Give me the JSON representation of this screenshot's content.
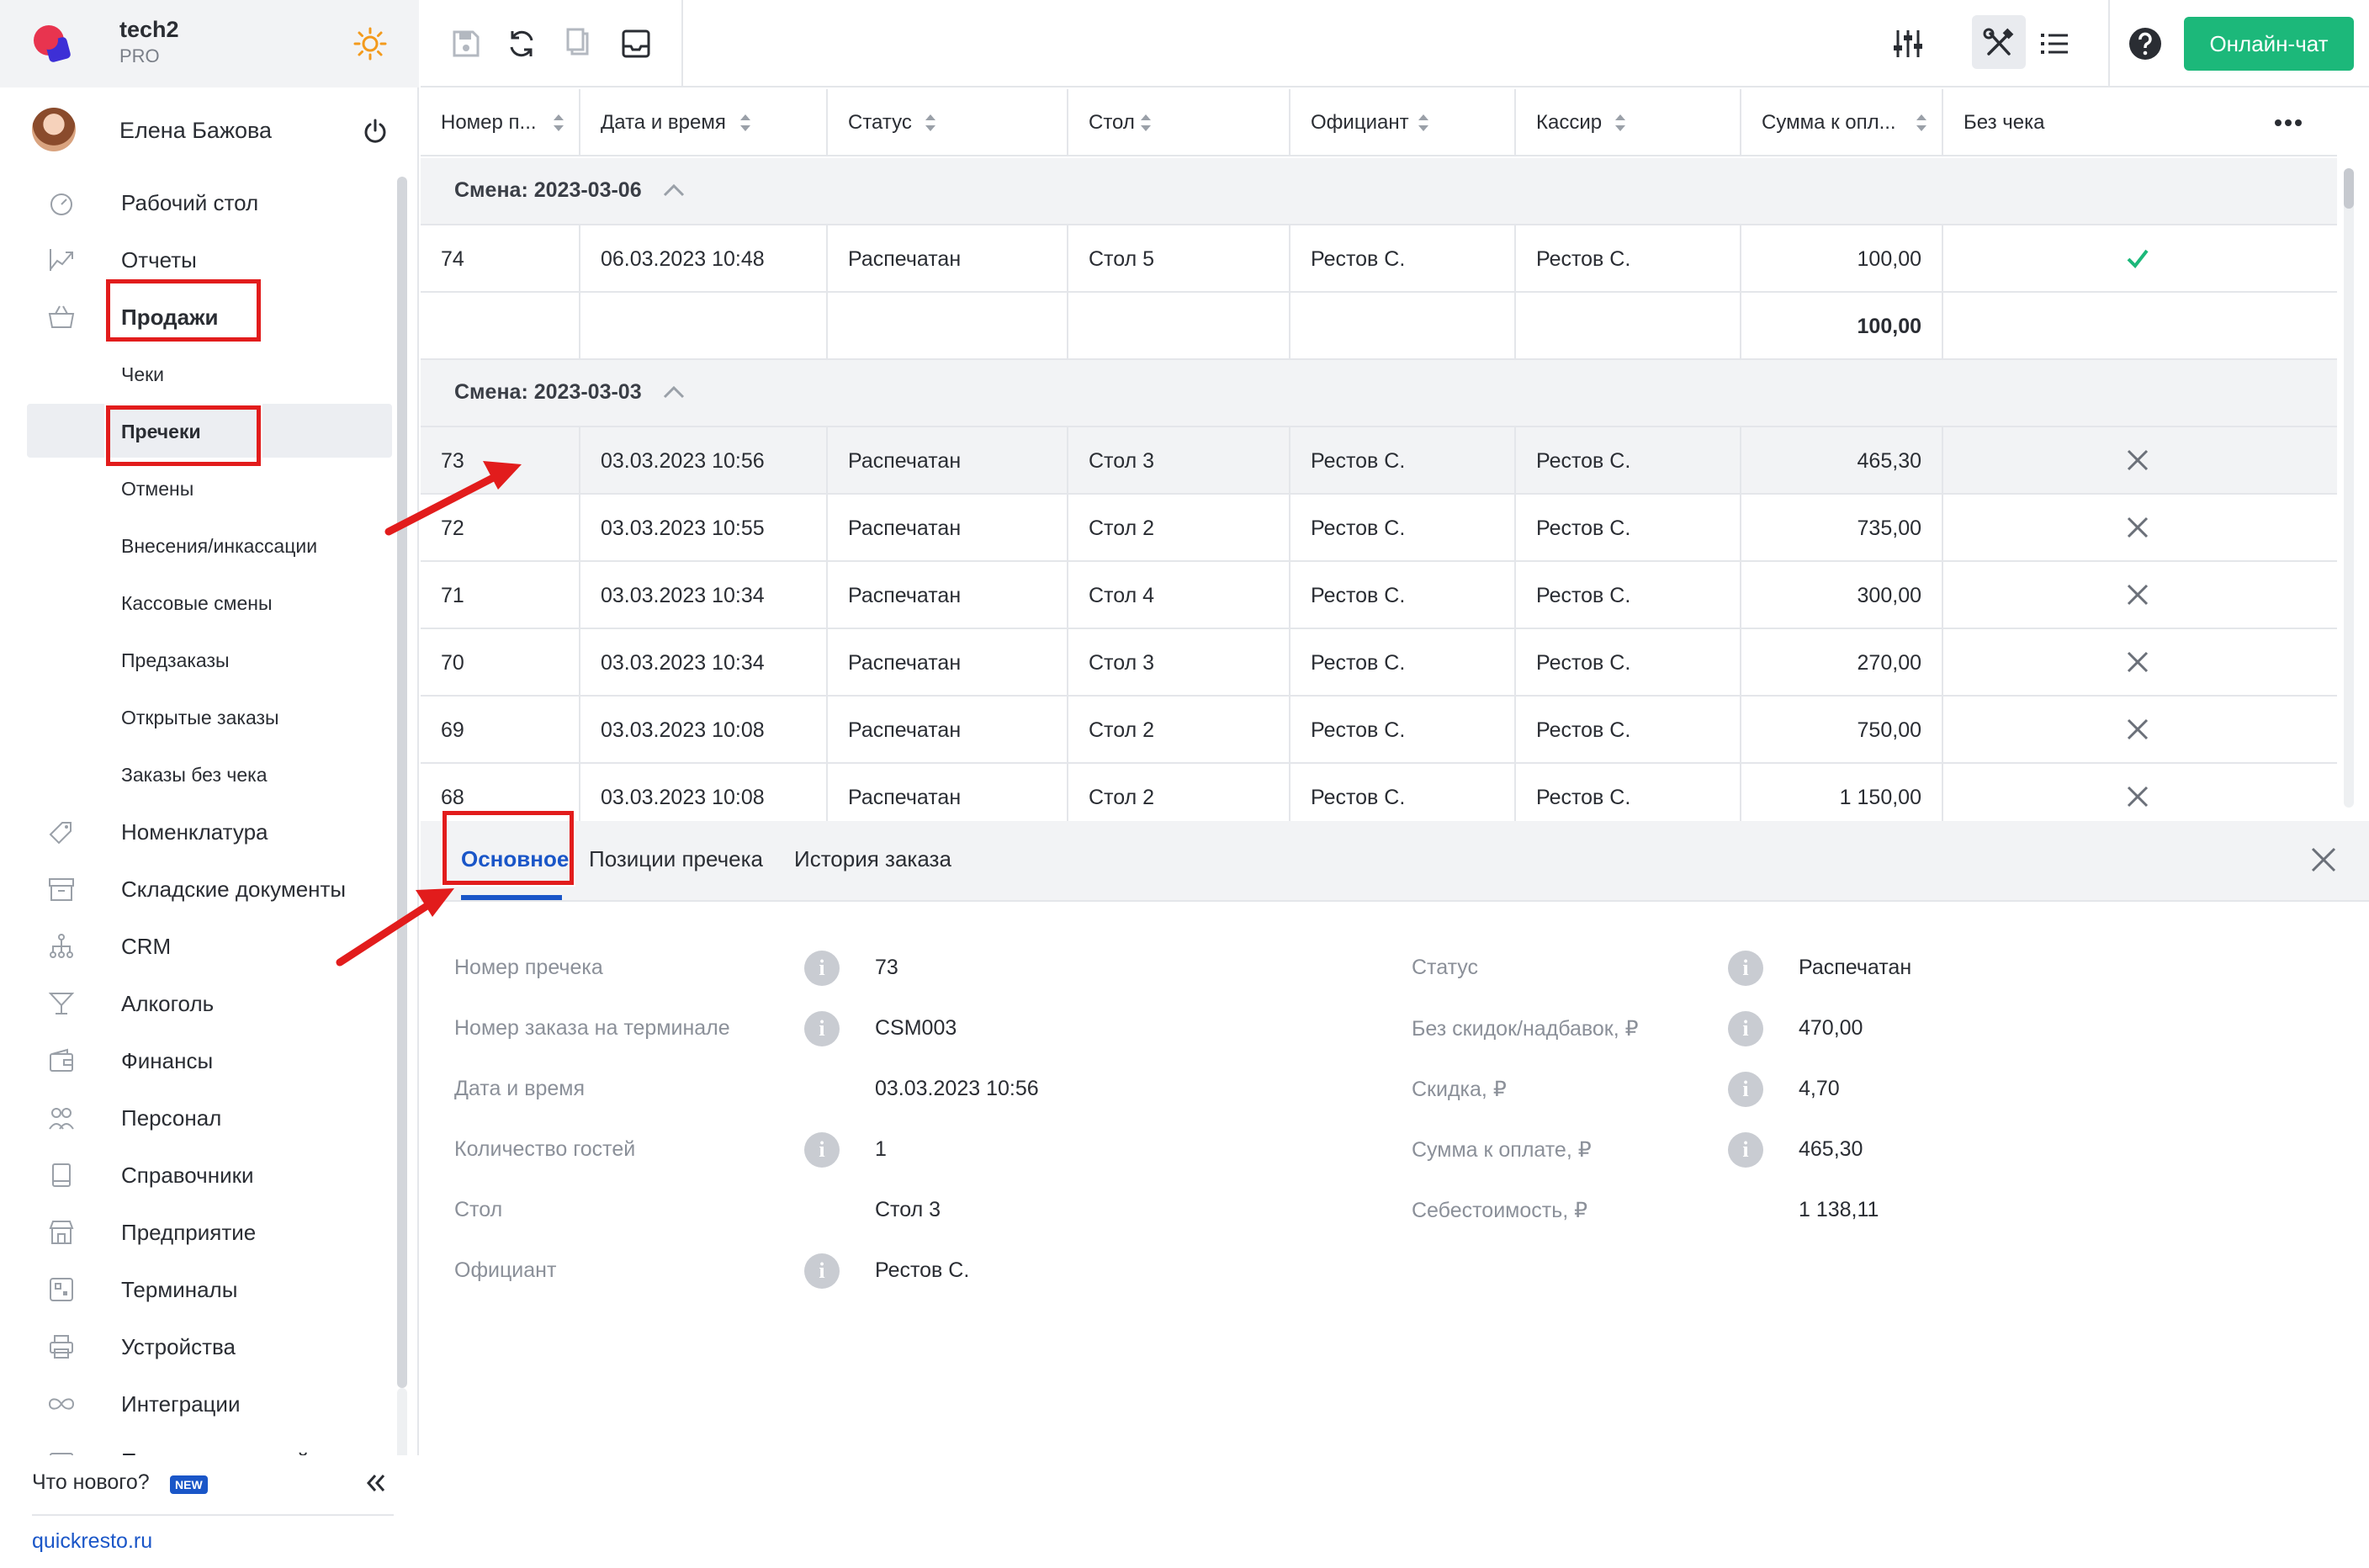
{
  "app": {
    "name": "tech2",
    "plan": "PRO"
  },
  "user": {
    "name": "Елена Бажова"
  },
  "sidebar": {
    "items": [
      {
        "label": "Рабочий стол",
        "icon": "dashboard-icon"
      },
      {
        "label": "Отчеты",
        "icon": "reports-icon"
      },
      {
        "label": "Продажи",
        "icon": "basket-icon"
      },
      {
        "label": "Чеки"
      },
      {
        "label": "Пречеки"
      },
      {
        "label": "Отмены"
      },
      {
        "label": "Внесения/инкассации"
      },
      {
        "label": "Кассовые смены"
      },
      {
        "label": "Предзаказы"
      },
      {
        "label": "Открытые заказы"
      },
      {
        "label": "Заказы без чека"
      },
      {
        "label": "Номенклатура",
        "icon": "tag-icon"
      },
      {
        "label": "Складские документы",
        "icon": "archive-icon"
      },
      {
        "label": "CRM",
        "icon": "hierarchy-icon"
      },
      {
        "label": "Алкоголь",
        "icon": "cocktail-icon"
      },
      {
        "label": "Финансы",
        "icon": "wallet-icon"
      },
      {
        "label": "Персонал",
        "icon": "people-icon"
      },
      {
        "label": "Справочники",
        "icon": "book-icon"
      },
      {
        "label": "Предприятие",
        "icon": "store-icon"
      },
      {
        "label": "Терминалы",
        "icon": "qr-terminal-icon"
      },
      {
        "label": "Устройства",
        "icon": "printer-icon"
      },
      {
        "label": "Интеграции",
        "icon": "infinity-icon"
      },
      {
        "label": "Приложение и сайт",
        "icon": "app-icon"
      }
    ],
    "footer": {
      "whats_new": "Что нового?",
      "badge": "NEW",
      "site": "quickresto.ru"
    }
  },
  "toolbar": {
    "chat_button": "Онлайн-чат"
  },
  "table": {
    "columns": [
      "Номер п...",
      "Дата и время",
      "Статус",
      "Стол",
      "Официант",
      "Кассир",
      "Сумма к опл...",
      "Без чека"
    ],
    "groups": [
      {
        "title": "Смена: 2023-03-06",
        "rows": [
          {
            "num": "74",
            "datetime": "06.03.2023 10:48",
            "status": "Распечатан",
            "table": "Стол 5",
            "waiter": "Рестов С.",
            "cashier": "Рестов С.",
            "sum": "100,00",
            "no_check": "yes"
          }
        ],
        "total": "100,00"
      },
      {
        "title": "Смена: 2023-03-03",
        "rows": [
          {
            "num": "73",
            "datetime": "03.03.2023 10:56",
            "status": "Распечатан",
            "table": "Стол 3",
            "waiter": "Рестов С.",
            "cashier": "Рестов С.",
            "sum": "465,30",
            "no_check": "no",
            "selected": true
          },
          {
            "num": "72",
            "datetime": "03.03.2023 10:55",
            "status": "Распечатан",
            "table": "Стол 2",
            "waiter": "Рестов С.",
            "cashier": "Рестов С.",
            "sum": "735,00",
            "no_check": "no"
          },
          {
            "num": "71",
            "datetime": "03.03.2023 10:34",
            "status": "Распечатан",
            "table": "Стол 4",
            "waiter": "Рестов С.",
            "cashier": "Рестов С.",
            "sum": "300,00",
            "no_check": "no"
          },
          {
            "num": "70",
            "datetime": "03.03.2023 10:34",
            "status": "Распечатан",
            "table": "Стол 3",
            "waiter": "Рестов С.",
            "cashier": "Рестов С.",
            "sum": "270,00",
            "no_check": "no"
          },
          {
            "num": "69",
            "datetime": "03.03.2023 10:08",
            "status": "Распечатан",
            "table": "Стол 2",
            "waiter": "Рестов С.",
            "cashier": "Рестов С.",
            "sum": "750,00",
            "no_check": "no"
          },
          {
            "num": "68",
            "datetime": "03.03.2023 10:08",
            "status": "Распечатан",
            "table": "Стол 2",
            "waiter": "Рестов С.",
            "cashier": "Рестов С.",
            "sum": "1 150,00",
            "no_check": "no"
          }
        ]
      }
    ]
  },
  "detail": {
    "tabs": [
      "Основное",
      "Позиции пречека",
      "История заказа"
    ],
    "left_fields": [
      {
        "label": "Номер пречека",
        "value": "73",
        "info": true
      },
      {
        "label": "Номер заказа на терминале",
        "value": "CSM003",
        "info": true
      },
      {
        "label": "Дата и время",
        "value": "03.03.2023 10:56",
        "info": false
      },
      {
        "label": "Количество гостей",
        "value": "1",
        "info": true
      },
      {
        "label": "Стол",
        "value": "Стол 3",
        "info": false
      },
      {
        "label": "Официант",
        "value": "Рестов С.",
        "info": true
      }
    ],
    "right_fields": [
      {
        "label": "Статус",
        "value": "Распечатан",
        "info": true
      },
      {
        "label": "Без скидок/надбавок, ₽",
        "value": "470,00",
        "info": true
      },
      {
        "label": "Скидка, ₽",
        "value": "4,70",
        "info": true
      },
      {
        "label": "Сумма к оплате, ₽",
        "value": "465,30",
        "info": true
      },
      {
        "label": "Себестоимость, ₽",
        "value": "1 138,11",
        "info": false
      }
    ]
  },
  "colors": {
    "accent": "#1a56c8",
    "chat": "#1cb87a",
    "check": "#1cb87a",
    "annotation": "#e21c1c"
  }
}
